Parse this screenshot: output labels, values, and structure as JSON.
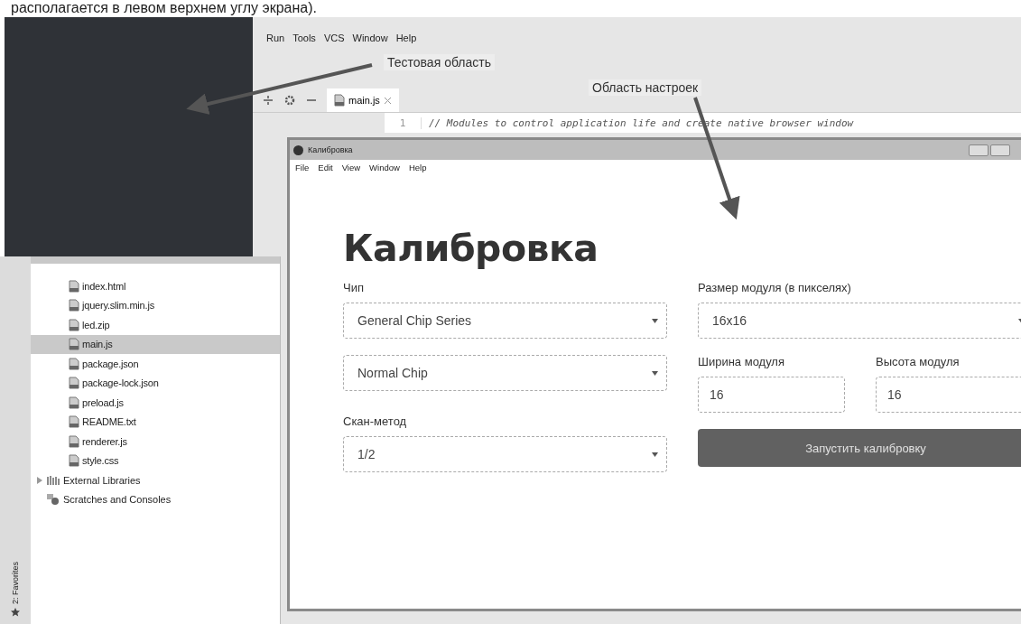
{
  "document_text": "располагается в левом верхнем углу экрана).",
  "ide": {
    "menu": [
      "Run",
      "Tools",
      "VCS",
      "Window",
      "Help"
    ],
    "tab": {
      "label": "main.js",
      "selected": true
    },
    "code_lines": [
      {
        "number": "1",
        "text": "// Modules to control application life and create native browser window"
      }
    ],
    "files": [
      {
        "name": "index.html",
        "selected": false
      },
      {
        "name": "jquery.slim.min.js",
        "selected": false
      },
      {
        "name": "led.zip",
        "selected": false
      },
      {
        "name": "main.js",
        "selected": true
      },
      {
        "name": "package.json",
        "selected": false
      },
      {
        "name": "package-lock.json",
        "selected": false
      },
      {
        "name": "preload.js",
        "selected": false
      },
      {
        "name": "README.txt",
        "selected": false
      },
      {
        "name": "renderer.js",
        "selected": false
      },
      {
        "name": "style.css",
        "selected": false
      }
    ],
    "tree_items": [
      {
        "label": "External Libraries",
        "kind": "libraries",
        "expanded": false
      },
      {
        "label": "Scratches and Consoles",
        "kind": "scratches"
      }
    ],
    "favorites_label": "2: Favorites"
  },
  "window": {
    "title": "Калибровка",
    "menu": [
      "File",
      "Edit",
      "View",
      "Window",
      "Help"
    ],
    "heading": "Калибровка",
    "left": [
      {
        "kind": "label",
        "text": "Чип"
      },
      {
        "kind": "select",
        "value": "General Chip Series"
      },
      {
        "kind": "select",
        "value": "Normal Chip"
      },
      {
        "kind": "label",
        "text": "Скан-метод"
      },
      {
        "kind": "select",
        "value": "1/2"
      }
    ],
    "right": [
      {
        "kind": "label",
        "text": "Размер модуля (в пикселях)"
      },
      {
        "kind": "select",
        "value": "16x16"
      },
      {
        "kind": "pair",
        "fields": [
          {
            "label": "Ширина модуля",
            "value": "16"
          },
          {
            "label": "Высота модуля",
            "value": "16"
          }
        ]
      },
      {
        "kind": "button",
        "text": "Запустить калибровку"
      }
    ]
  },
  "annotations": [
    {
      "text": "Тестовая область"
    },
    {
      "text": "Область настроек"
    }
  ]
}
